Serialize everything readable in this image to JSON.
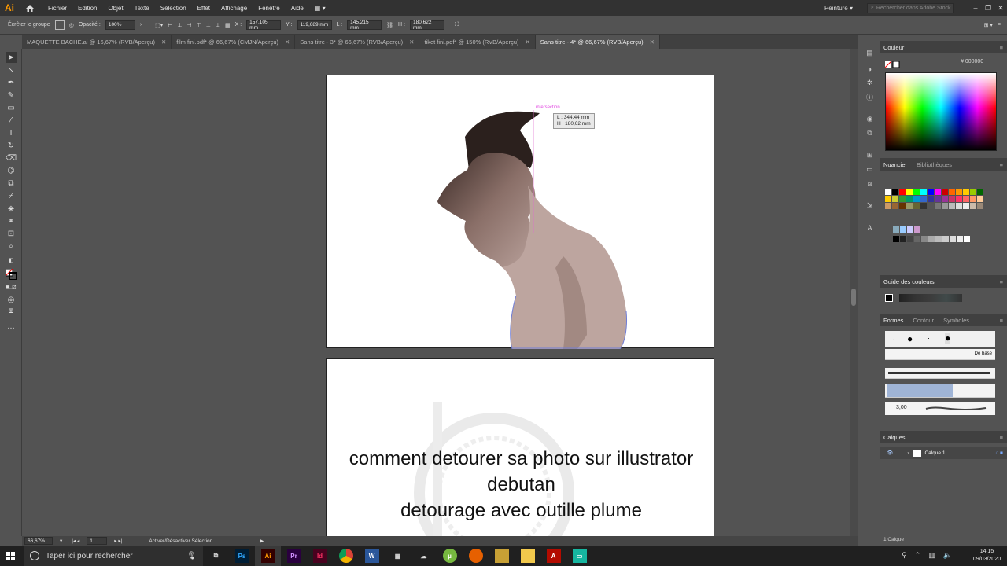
{
  "app": {
    "logo": "Ai"
  },
  "menu": [
    "Fichier",
    "Edition",
    "Objet",
    "Texte",
    "Sélection",
    "Effet",
    "Affichage",
    "Fenêtre",
    "Aide"
  ],
  "workspace": "Peinture",
  "stock_search": {
    "placeholder": "Rechercher dans Adobe Stock"
  },
  "control": {
    "group_label": "Écrêter le groupe",
    "opacity_label": "Opacité :",
    "opacity_value": "100%",
    "x_label": "X :",
    "x_value": "157,105 mm",
    "y_label": "Y :",
    "y_value": "119,689 mm",
    "w_label": "L :",
    "w_value": "145,215 mm",
    "h_label": "H :",
    "h_value": "180,622 mm"
  },
  "tabs": [
    {
      "label": "MAQUETTE BACHE.ai @ 16,67% (RVB/Aperçu)"
    },
    {
      "label": "film fini.pdf* @ 66,67% (CMJN/Aperçu)"
    },
    {
      "label": "Sans titre - 3* @ 66,67% (RVB/Aperçu)"
    },
    {
      "label": "tiket fini.pdf* @ 150% (RVB/Aperçu)"
    },
    {
      "label": "Sans titre - 4* @ 66,67% (RVB/Aperçu)"
    }
  ],
  "canvas": {
    "smart_guide": "intersection",
    "tooltip_line1": "L : 344,44 mm",
    "tooltip_line2": "H : 180,62 mm",
    "caption_line1": "comment detourer sa photo sur illustrator",
    "caption_line2": "debutan",
    "caption_line3": "detourage avec outille plume"
  },
  "panels": {
    "color": {
      "title": "Couleur",
      "hex": "000000"
    },
    "swatches": {
      "title": "Nuancier",
      "tab2": "Bibliothèques"
    },
    "color_guide": {
      "title": "Guide des couleurs"
    },
    "brushes": {
      "title": "Formes",
      "tab2": "Contour",
      "tab3": "Symboles",
      "basic_label": "De base",
      "stroke_value": "3,00"
    },
    "layers": {
      "title": "Calques",
      "layer_name": "Calque 1",
      "count": "1 Calque"
    }
  },
  "status": {
    "zoom": "66,67%",
    "page": "1",
    "action": "Activer/Désactiver Sélection"
  },
  "taskbar": {
    "search_placeholder": "Taper ici pour rechercher",
    "time": "14:15",
    "date": "09/03/2020"
  },
  "colors": {
    "accent": "#ff9a00",
    "panel_bg": "#535353",
    "dark_bar": "#323232"
  }
}
